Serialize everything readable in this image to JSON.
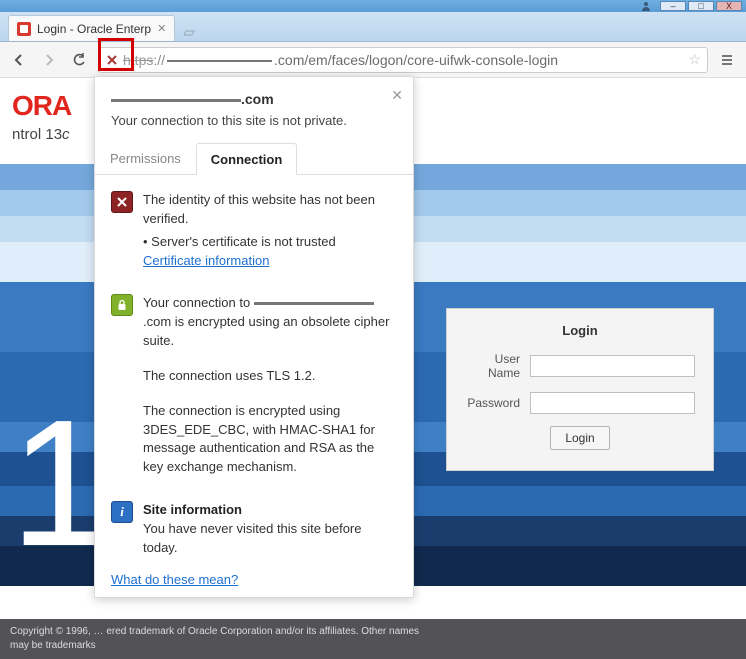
{
  "window": {
    "buttons": {
      "minimize": "–",
      "maximize": "□",
      "close": "X"
    }
  },
  "tab": {
    "title": "Login - Oracle Enterp"
  },
  "url": {
    "scheme": "https",
    "visible_path": ".com/em/faces/logon/core-uifwk-console-login"
  },
  "app": {
    "logo_text": "ORA",
    "title_left": "",
    "title_right": "ntrol 13",
    "title_right_ital": "c",
    "big_number": "1"
  },
  "login": {
    "title": "Login",
    "username_label": "User Name",
    "password_label": "Password",
    "submit": "Login"
  },
  "footer": {
    "line1_left": "Copyright © 1996, ",
    "line1_right": "ered trademark of Oracle Corporation and/or its affiliates. Other names",
    "line2": "may be trademarks"
  },
  "popover": {
    "host_suffix": ".com",
    "subtitle": "Your connection to this site is not private.",
    "tabs": {
      "permissions": "Permissions",
      "connection": "Connection"
    },
    "identity": {
      "line1": "The identity of this website has not been verified.",
      "bullet": " • Server's certificate is not trusted",
      "cert_link": "Certificate information"
    },
    "encryption": {
      "p1a": "Your connection to ",
      "p1b": ".com is encrypted using an obsolete cipher suite.",
      "p2": "The connection uses TLS 1.2.",
      "p3": "The connection is encrypted using 3DES_EDE_CBC, with HMAC-SHA1 for message authentication and RSA as the key exchange mechanism."
    },
    "siteinfo": {
      "title": "Site information",
      "body": "You have never visited this site before today."
    },
    "more": "What do these mean?"
  }
}
